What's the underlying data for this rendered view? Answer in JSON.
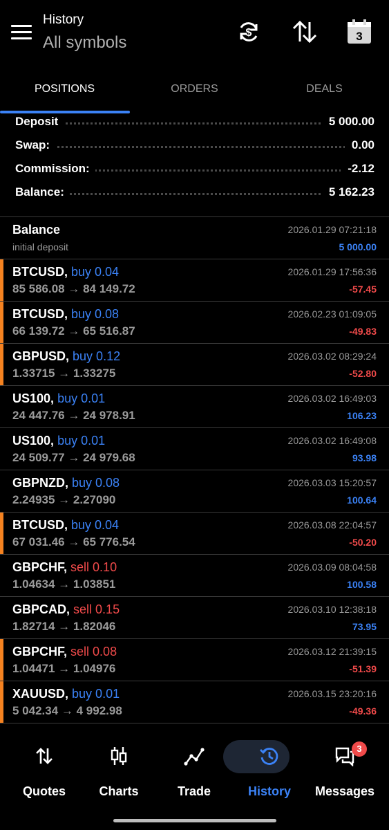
{
  "header": {
    "subtitle": "History",
    "title": "All symbols",
    "calendar_day": "3",
    "icons": [
      "menu-icon",
      "currency-exchange-icon",
      "sort-icon",
      "calendar-icon"
    ]
  },
  "tabs": [
    {
      "label": "POSITIONS",
      "active": true
    },
    {
      "label": "ORDERS",
      "active": false
    },
    {
      "label": "DEALS",
      "active": false
    }
  ],
  "summary": [
    {
      "label": "Deposit",
      "value": "5 000.00"
    },
    {
      "label": "Swap:",
      "value": "0.00"
    },
    {
      "label": "Commission:",
      "value": "-2.12"
    },
    {
      "label": "Balance:",
      "value": "5 162.23"
    }
  ],
  "balance_entry": {
    "title": "Balance",
    "note": "initial deposit",
    "time": "2026.01.29 07:21:18",
    "amount": "5 000.00"
  },
  "positions": [
    {
      "symbol": "BTCUSD,",
      "dir": "buy",
      "direction": "buy 0.04",
      "prices": "85 586.08 → 84 149.72",
      "time": "2026.01.29 17:56:36",
      "profit": "-57.45",
      "loss": true
    },
    {
      "symbol": "BTCUSD,",
      "dir": "buy",
      "direction": "buy 0.08",
      "prices": "66 139.72 → 65 516.87",
      "time": "2026.02.23 01:09:05",
      "profit": "-49.83",
      "loss": true
    },
    {
      "symbol": "GBPUSD,",
      "dir": "buy",
      "direction": "buy 0.12",
      "prices": "1.33715 → 1.33275",
      "time": "2026.03.02 08:29:24",
      "profit": "-52.80",
      "loss": true
    },
    {
      "symbol": "US100,",
      "dir": "buy",
      "direction": "buy 0.01",
      "prices": "24 447.76 → 24 978.91",
      "time": "2026.03.02 16:49:03",
      "profit": "106.23",
      "loss": false
    },
    {
      "symbol": "US100,",
      "dir": "buy",
      "direction": "buy 0.01",
      "prices": "24 509.77 → 24 979.68",
      "time": "2026.03.02 16:49:08",
      "profit": "93.98",
      "loss": false
    },
    {
      "symbol": "GBPNZD,",
      "dir": "buy",
      "direction": "buy 0.08",
      "prices": "2.24935 → 2.27090",
      "time": "2026.03.03 15:20:57",
      "profit": "100.64",
      "loss": false
    },
    {
      "symbol": "BTCUSD,",
      "dir": "buy",
      "direction": "buy 0.04",
      "prices": "67 031.46 → 65 776.54",
      "time": "2026.03.08 22:04:57",
      "profit": "-50.20",
      "loss": true
    },
    {
      "symbol": "GBPCHF,",
      "dir": "sell",
      "direction": "sell 0.10",
      "prices": "1.04634 → 1.03851",
      "time": "2026.03.09 08:04:58",
      "profit": "100.58",
      "loss": false
    },
    {
      "symbol": "GBPCAD,",
      "dir": "sell",
      "direction": "sell 0.15",
      "prices": "1.82714 → 1.82046",
      "time": "2026.03.10 12:38:18",
      "profit": "73.95",
      "loss": false
    },
    {
      "symbol": "GBPCHF,",
      "dir": "sell",
      "direction": "sell 0.08",
      "prices": "1.04471 → 1.04976",
      "time": "2026.03.12 21:39:15",
      "profit": "-51.39",
      "loss": true
    },
    {
      "symbol": "XAUUSD,",
      "dir": "buy",
      "direction": "buy 0.01",
      "prices": "5 042.34 → 4 992.98",
      "time": "2026.03.15 23:20:16",
      "profit": "-49.36",
      "loss": true
    }
  ],
  "nav": [
    {
      "label": "Quotes",
      "icon": "swap-vertical-icon",
      "active": false
    },
    {
      "label": "Charts",
      "icon": "candlestick-icon",
      "active": false
    },
    {
      "label": "Trade",
      "icon": "trend-line-icon",
      "active": false
    },
    {
      "label": "History",
      "icon": "history-icon",
      "active": true
    },
    {
      "label": "Messages",
      "icon": "chat-icon",
      "active": false,
      "badge": "3"
    }
  ],
  "colors": {
    "accent": "#3b82f6",
    "loss": "#f04a4a",
    "loss_marker": "#f58220",
    "background": "#000000"
  }
}
